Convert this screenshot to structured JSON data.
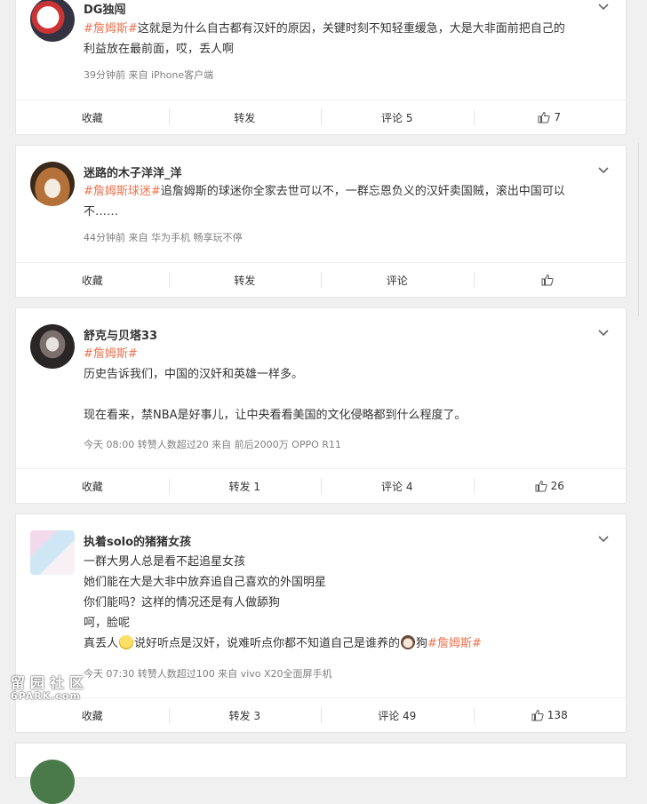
{
  "posts": [
    {
      "author": "DG独闯",
      "lines": [
        {
          "topic": "#詹姆斯#",
          "text": "这就是为什么自古都有汉奸的原因，关键时刻不知轻重缓急，大是大非面前把自己的"
        },
        {
          "text": "利益放在最前面，哎，丢人啊"
        }
      ],
      "meta": "39分钟前  来自 iPhone客户端",
      "actions": {
        "favorite": "收藏",
        "repost": "转发",
        "comment": "评论 5",
        "like": "7"
      }
    },
    {
      "author": "迷路的木子洋洋_洋",
      "lines": [
        {
          "topic": "#詹姆斯球迷#",
          "text": "追詹姆斯的球迷你全家去世可以不，一群忘恩负义的汉奸卖国贼，滚出中国可以"
        },
        {
          "text": "不……"
        }
      ],
      "meta": "44分钟前  来自 华为手机 畅享玩不停",
      "actions": {
        "favorite": "收藏",
        "repost": "转发",
        "comment": "评论",
        "like": ""
      }
    },
    {
      "author": "舒克与贝塔33",
      "lines": [
        {
          "topic": "#詹姆斯#"
        },
        {
          "text": "历史告诉我们，中国的汉奸和英雄一样多。"
        },
        {
          "text": ""
        },
        {
          "text": "现在看来，禁NBA是好事儿，让中央看看美国的文化侵略都到什么程度了。"
        }
      ],
      "meta": "今天 08:00  转赞人数超过20  来自 前后2000万 OPPO R11",
      "actions": {
        "favorite": "收藏",
        "repost": "转发 1",
        "comment": "评论 4",
        "like": "26"
      }
    },
    {
      "author": "执着solo的猪猪女孩",
      "lines": [
        {
          "text": "一群大男人总是看不起追星女孩"
        },
        {
          "text": "她们能在大是大非中放弃追自己喜欢的外国明星"
        },
        {
          "text": "你们能吗？这样的情况还是有人做舔狗"
        },
        {
          "text": "呵，脸呢"
        }
      ],
      "last_line": {
        "a": "真丢人",
        "b": "说好听点是汉奸，说难听点你都不知道自己是谁养的",
        "c": "狗",
        "topic": "#詹姆斯#"
      },
      "meta": "今天 07:30  转赞人数超过100  来自 vivo X20全面屏手机",
      "actions": {
        "favorite": "收藏",
        "repost": "转发 3",
        "comment": "评论 49",
        "like": "138"
      }
    }
  ],
  "watermark": {
    "line1": "留园社区",
    "line2": "6PARK.com"
  },
  "colors": {
    "topic": "#eb7350",
    "meta": "#808080",
    "background": "#f0f0f0"
  }
}
